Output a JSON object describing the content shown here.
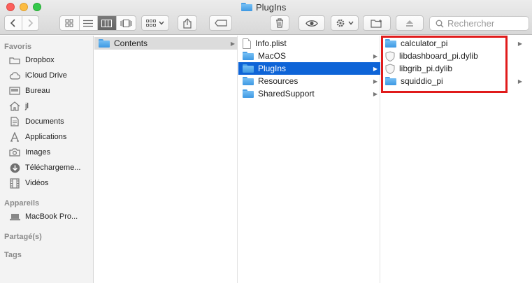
{
  "window": {
    "title": "PlugIns"
  },
  "toolbar": {
    "search_placeholder": "Rechercher"
  },
  "sidebar": {
    "sections": [
      {
        "label": "Favoris"
      },
      {
        "label": "Appareils"
      },
      {
        "label": "Partagé(s)"
      },
      {
        "label": "Tags"
      }
    ],
    "favorites": [
      {
        "label": "Dropbox",
        "icon": "dropbox-icon"
      },
      {
        "label": "iCloud Drive",
        "icon": "cloud-icon"
      },
      {
        "label": "Bureau",
        "icon": "desktop-icon"
      },
      {
        "label": "jl",
        "icon": "home-icon"
      },
      {
        "label": "Documents",
        "icon": "documents-icon"
      },
      {
        "label": "Applications",
        "icon": "applications-icon"
      },
      {
        "label": "Images",
        "icon": "camera-icon"
      },
      {
        "label": "Téléchargeme...",
        "icon": "downloads-icon"
      },
      {
        "label": "Vidéos",
        "icon": "film-icon"
      }
    ],
    "devices": [
      {
        "label": "MacBook Pro...",
        "icon": "laptop-icon"
      }
    ]
  },
  "columns": [
    {
      "items": [
        {
          "name": "Contents",
          "type": "folder",
          "selected": "gray"
        }
      ]
    },
    {
      "items": [
        {
          "name": "Info.plist",
          "type": "file"
        },
        {
          "name": "MacOS",
          "type": "folder"
        },
        {
          "name": "PlugIns",
          "type": "folder",
          "selected": "blue"
        },
        {
          "name": "Resources",
          "type": "folder"
        },
        {
          "name": "SharedSupport",
          "type": "folder"
        }
      ]
    },
    {
      "items": [
        {
          "name": "calculator_pi",
          "type": "folder"
        },
        {
          "name": "libdashboard_pi.dylib",
          "type": "library"
        },
        {
          "name": "libgrib_pi.dylib",
          "type": "library"
        },
        {
          "name": "squiddio_pi",
          "type": "folder"
        }
      ]
    }
  ],
  "colors": {
    "selection_blue": "#0e64d7",
    "highlight_red": "#e01b1b",
    "folder_blue": "#3d98e3"
  }
}
